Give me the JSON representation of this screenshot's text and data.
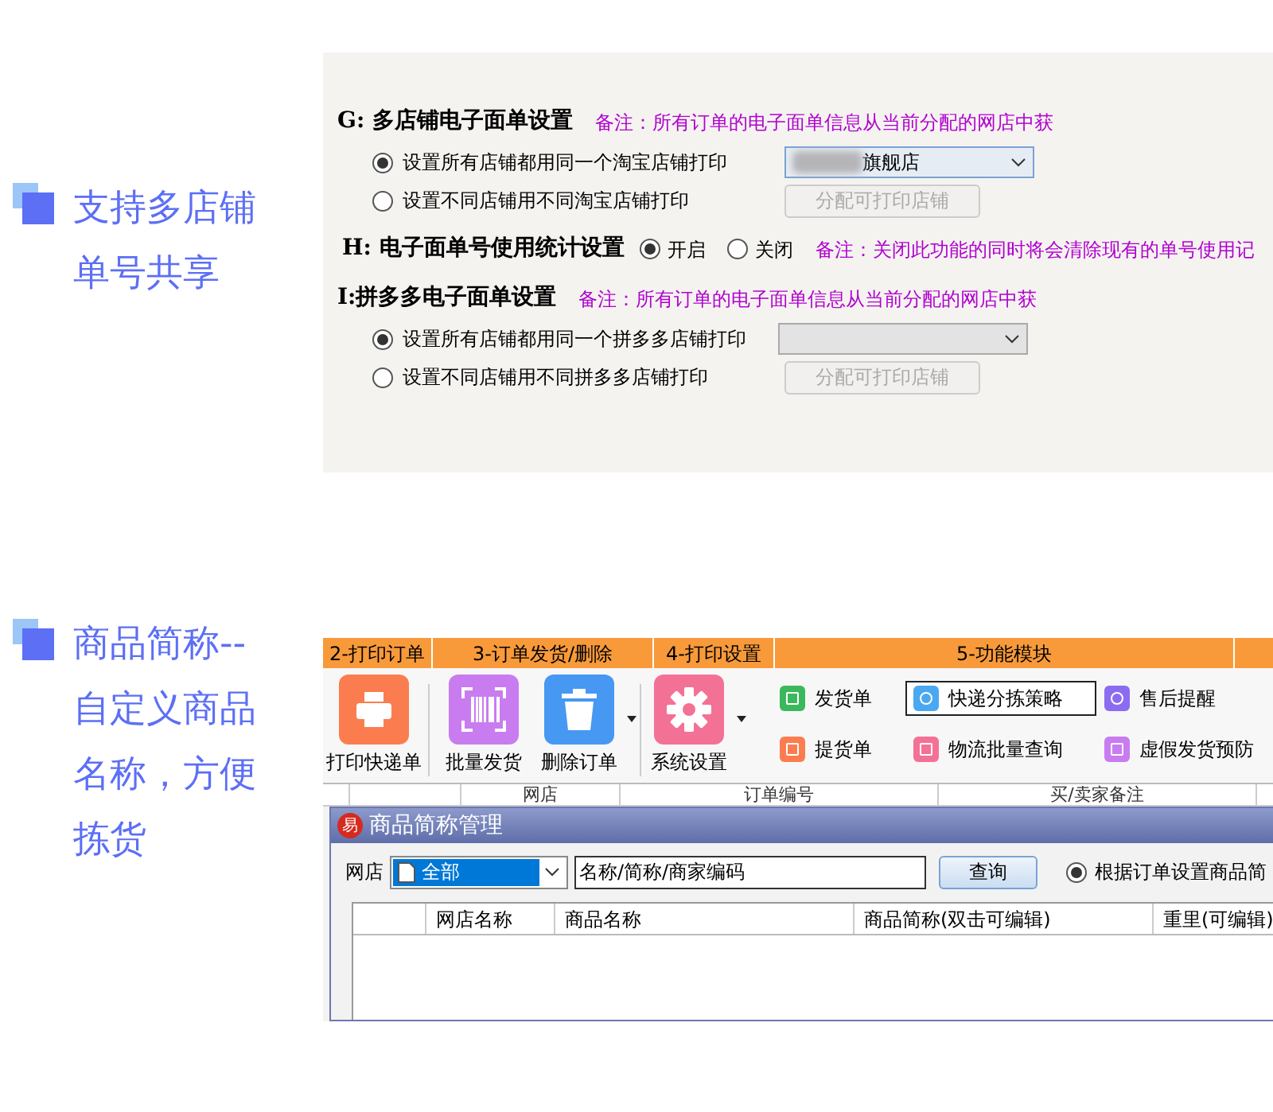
{
  "features": [
    {
      "text": "支持多店铺单号共享"
    },
    {
      "text": "商品简称--自定义商品名称，方便拣货"
    }
  ],
  "settings": {
    "sections": [
      {
        "kind": "group",
        "title": "G: 多店铺电子面单设置",
        "note": "备注：所有订单的电子面单信息从当前分配的网店中获",
        "options": [
          {
            "label": "设置所有店铺都用同一个淘宝店铺打印",
            "selected": true,
            "dropdown": {
              "value": "旗舰店",
              "masked": true,
              "disabled": false
            }
          },
          {
            "label": "设置不同店铺用不同淘宝店铺打印",
            "selected": false,
            "button": {
              "label": "分配可打印店铺",
              "disabled": true
            }
          }
        ]
      },
      {
        "kind": "inline",
        "title": "H: 电子面单号使用统计设置",
        "note": "备注：关闭此功能的同时将会清除现有的单号使用记",
        "options": [
          {
            "label": "开启",
            "selected": true
          },
          {
            "label": "关闭",
            "selected": false
          }
        ]
      },
      {
        "kind": "group",
        "title": "I:拼多多电子面单设置",
        "note": "备注：所有订单的电子面单信息从当前分配的网店中获",
        "options": [
          {
            "label": "设置所有店铺都用同一个拼多多店铺打印",
            "selected": true,
            "dropdown": {
              "masked": false,
              "disabled": true
            }
          },
          {
            "label": "设置不同店铺用不同拼多多店铺打印",
            "selected": false,
            "button": {
              "label": "分配可打印店铺",
              "disabled": true
            }
          }
        ]
      }
    ]
  },
  "toolbar": {
    "groups": [
      "2-打印订单",
      "3-订单发货/删除",
      "4-打印设置",
      "5-功能模块"
    ],
    "big_buttons": [
      {
        "label": "打印快递单",
        "kind": "printer",
        "color": "#fb7d4f",
        "caret": false
      },
      {
        "label": "批量发货",
        "kind": "barcode",
        "color": "#c97cf0",
        "caret": false
      },
      {
        "label": "删除订单",
        "kind": "trash",
        "color": "#4698f2",
        "caret": true
      },
      {
        "label": "系统设置",
        "kind": "gear",
        "color": "#f47196",
        "caret": true
      }
    ],
    "small_buttons": [
      {
        "label": "发货单",
        "kind": "bill",
        "color": "#3cb85c",
        "selected": false
      },
      {
        "label": "快递分拣策略",
        "kind": "sort",
        "color": "#4aa8f0",
        "selected": true
      },
      {
        "label": "售后提醒",
        "kind": "headset",
        "color": "#8b6cf0",
        "selected": false
      },
      {
        "label": "提货单",
        "kind": "note",
        "color": "#fb7d4f",
        "selected": false
      },
      {
        "label": "物流批量查询",
        "kind": "truck",
        "color": "#f47196",
        "selected": false
      },
      {
        "label": "虚假发货预防",
        "kind": "shield",
        "color": "#c97cf0",
        "selected": false
      }
    ]
  },
  "order_table": {
    "columns": [
      "网店",
      "订单编号",
      "买/卖家备注"
    ]
  },
  "dialog": {
    "logo": "易",
    "title": "商品简称管理",
    "shop_label": "网店",
    "shop_value": "全部",
    "search": {
      "value": "名称/简称/商家编码"
    },
    "query_button": "查询",
    "radio": {
      "label": "根据订单设置商品简",
      "selected": true
    },
    "columns": [
      "网店名称",
      "商品名称",
      "商品简称(双击可编辑)",
      "重里(可编辑)"
    ]
  }
}
